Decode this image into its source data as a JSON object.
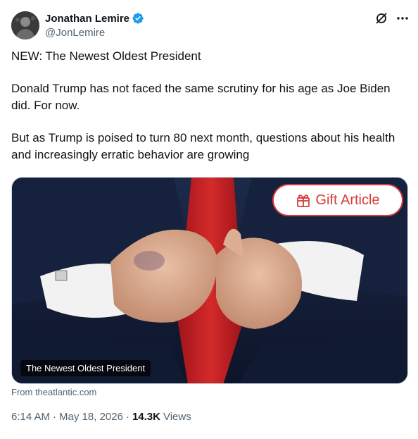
{
  "author": {
    "display_name": "Jonathan Lemire",
    "handle": "@JonLemire",
    "verified": true,
    "verified_color": "#1d9bf0",
    "avatar_icon": "avatar-photo"
  },
  "actions": {
    "grok_icon": "grok-icon",
    "more_icon": "more-icon"
  },
  "tweet": {
    "paragraphs": [
      "NEW: The Newest Oldest President",
      "Donald Trump has not faced the same scrutiny for his age as Joe Biden did. For now.",
      "But as Trump is poised to turn 80 next month, questions about his health and increasingly erratic behavior are growing"
    ]
  },
  "card": {
    "badge_label": "Gift Article",
    "badge_color": "#d93a3a",
    "badge_icon": "gift-icon",
    "caption": "The Newest Oldest President",
    "source": "From theatlantic.com"
  },
  "meta": {
    "time": "6:14 AM",
    "date": "May 18, 2026",
    "views_count": "14.3K",
    "views_label": "Views"
  }
}
